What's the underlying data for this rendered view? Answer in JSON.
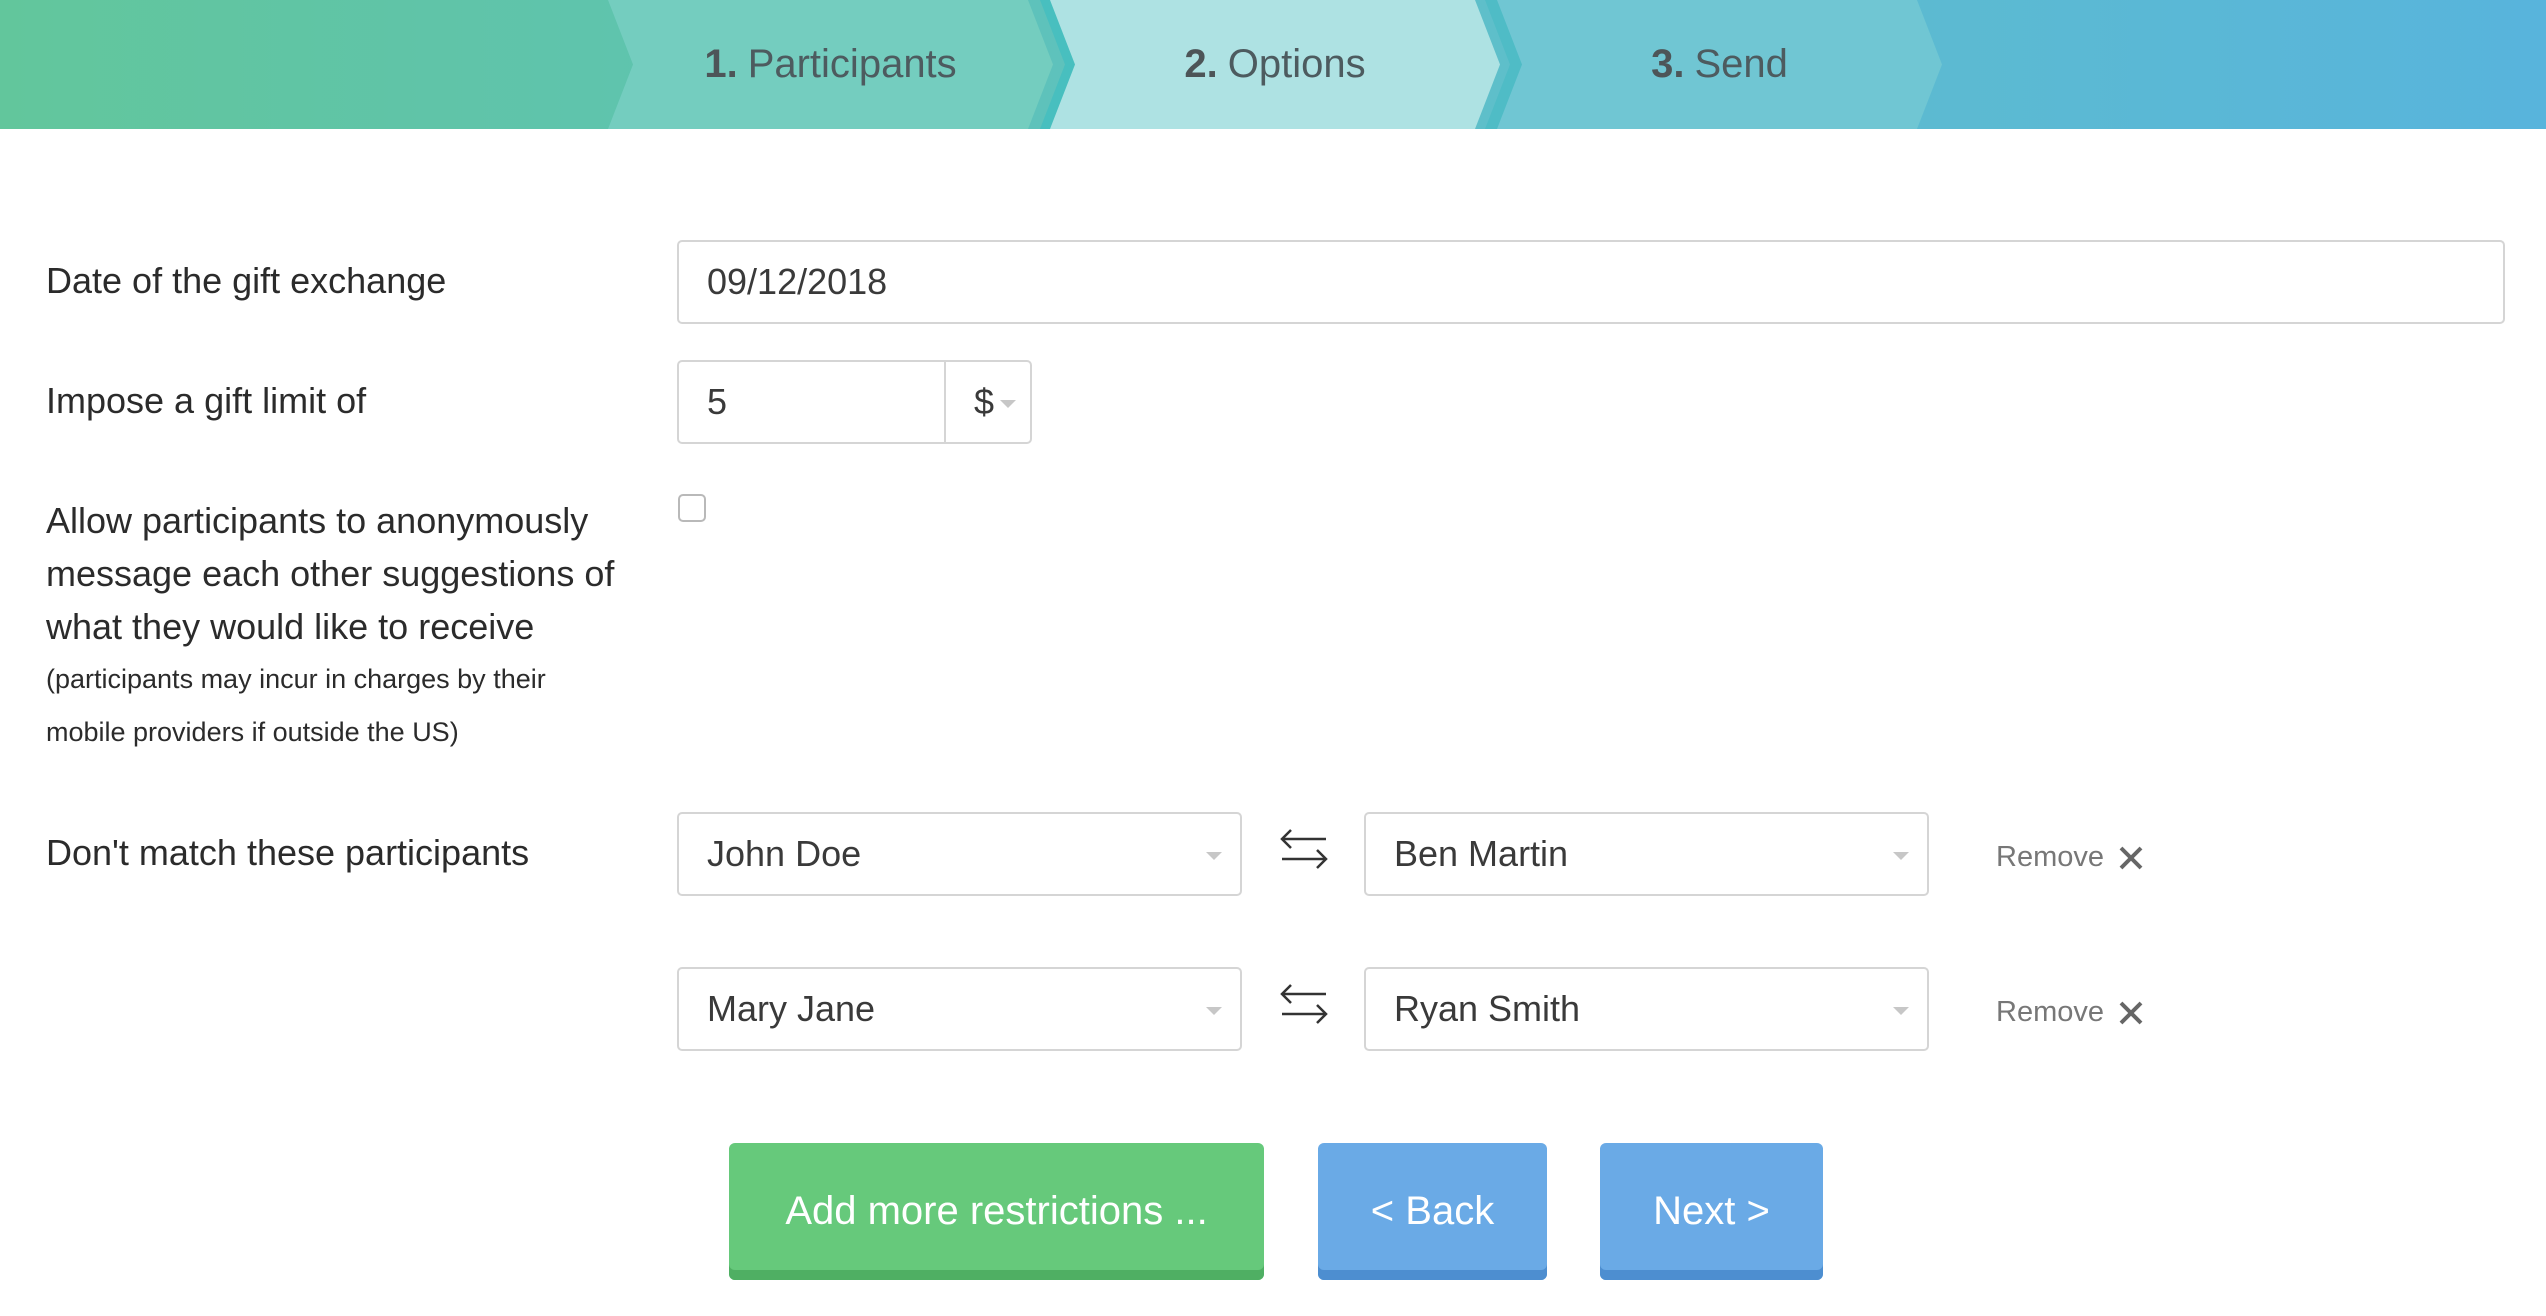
{
  "steps": [
    {
      "number": "1.",
      "label": "Participants"
    },
    {
      "number": "2.",
      "label": "Options"
    },
    {
      "number": "3.",
      "label": "Send"
    }
  ],
  "form": {
    "date": {
      "label": "Date of the gift exchange",
      "value": "09/12/2018"
    },
    "limit": {
      "label": "Impose a gift limit of",
      "value": "5",
      "currency": "$"
    },
    "messaging": {
      "label_lines": [
        "Allow participants to anonymously",
        "message each other suggestions of",
        "what they would like to receive"
      ],
      "note_lines": [
        "(participants may incur in charges by their",
        "mobile providers if outside the US)"
      ],
      "checked": false
    },
    "restrictions": {
      "label": "Don't match these participants",
      "pairs": [
        {
          "left": "John Doe",
          "right": "Ben Martin",
          "remove_label": "Remove"
        },
        {
          "left": "Mary Jane",
          "right": "Ryan Smith",
          "remove_label": "Remove"
        }
      ]
    }
  },
  "buttons": {
    "add_more": "Add more restrictions ...",
    "back": "< Back",
    "next": "Next >"
  },
  "colors": {
    "active_step": "#aee2e3",
    "add_button": "#66c97b",
    "nav_button": "#6aaae6"
  },
  "icons": {
    "swap": "swap-arrows-icon",
    "remove": "close-icon",
    "dropdown": "chevron-down-icon"
  }
}
